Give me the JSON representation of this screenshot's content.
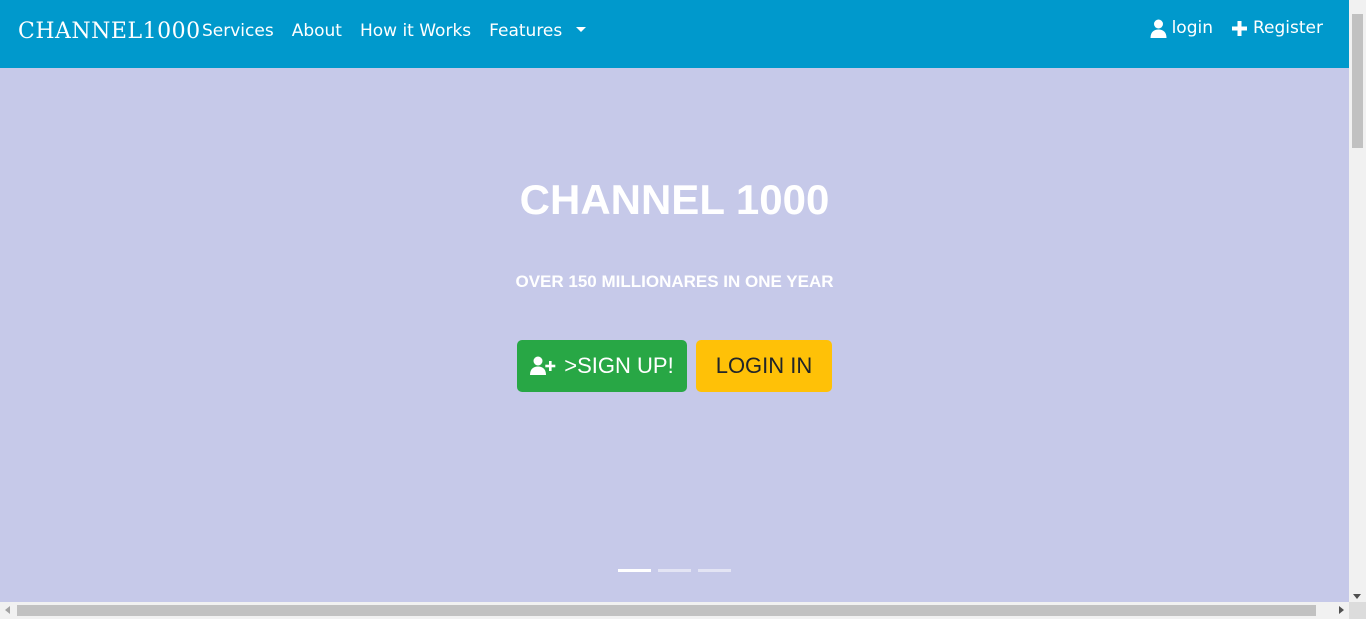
{
  "navbar": {
    "brand": "CHANNEL1000",
    "links": [
      {
        "label": "Services"
      },
      {
        "label": "About"
      },
      {
        "label": "How it Works"
      },
      {
        "label": "Features"
      }
    ],
    "right": {
      "login_label": "login",
      "login_icon": "user-icon",
      "register_label": "Register",
      "register_icon": "plus-icon"
    },
    "background": "#0099cc"
  },
  "hero": {
    "title": "CHANNEL 1000",
    "subtitle": "OVER 150 MILLIONARES IN ONE YEAR",
    "signup_button": {
      "label": ">SIGN UP!",
      "icon": "user-plus-icon",
      "color": "#28a745"
    },
    "login_button": {
      "label": "LOGIN IN",
      "color": "#ffc107"
    },
    "background": "#c6c9e9",
    "carousel": {
      "slides": 3,
      "active": 1
    }
  }
}
